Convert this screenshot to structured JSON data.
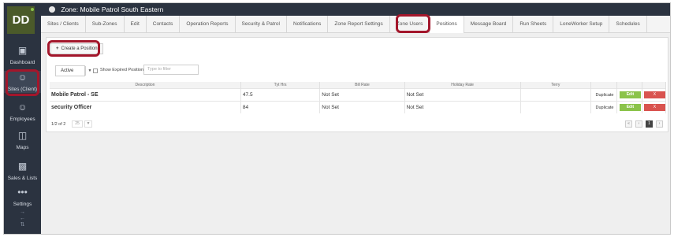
{
  "sidebar": {
    "logo": "DD",
    "items": [
      {
        "label": "Dashboard",
        "icon": "monitor-icon"
      },
      {
        "label": "Sites (Client)",
        "icon": "people-icon"
      },
      {
        "label": "Employees",
        "icon": "people-icon"
      },
      {
        "label": "Maps",
        "icon": "map-icon"
      },
      {
        "label": "Sales & Lists",
        "icon": "chart-icon"
      },
      {
        "label": "Settings",
        "icon": "dots-icon"
      }
    ]
  },
  "header": {
    "title": "Zone: Mobile Patrol South Eastern"
  },
  "tabs": [
    "Sites / Clients",
    "Sub-Zones",
    "Edit",
    "Contacts",
    "Operation Reports",
    "Security & Patrol",
    "Notifications",
    "Zone Report Settings",
    "Zone Users",
    "Positions",
    "Message Board",
    "Run Sheets",
    "LoneWorker Setup",
    "Schedules"
  ],
  "toolbar": {
    "create_label": "Create a Position",
    "status_value": "Active",
    "show_expired_label": "Show Expired Positions",
    "filter_placeholder": "Type to filter"
  },
  "table": {
    "headers": [
      "Description",
      "Tyt Hrs",
      "Bill Rate",
      "Holiday Rate",
      "Terry",
      "",
      "",
      ""
    ],
    "rows": [
      {
        "description": "Mobile Patrol - SE",
        "hrs": "47.5",
        "bill": "Not Set",
        "holiday": "Not Set",
        "terry": "",
        "duplicate": "Duplicate",
        "edit": "Edit",
        "delete": "X"
      },
      {
        "description": "security Officer",
        "hrs": "84",
        "bill": "Not Set",
        "holiday": "Not Set",
        "terry": "",
        "duplicate": "Duplicate",
        "edit": "Edit",
        "delete": "X"
      }
    ]
  },
  "pager": {
    "info": "1/2 of 2",
    "size": "25",
    "current_page": "1",
    "prev2": "«",
    "prev": "‹",
    "next": "›",
    "next2": "»"
  },
  "colors": {
    "sidebar": "#2b3340",
    "highlight": "#a3162b",
    "edit": "#8bc34a",
    "delete": "#d9534f"
  }
}
